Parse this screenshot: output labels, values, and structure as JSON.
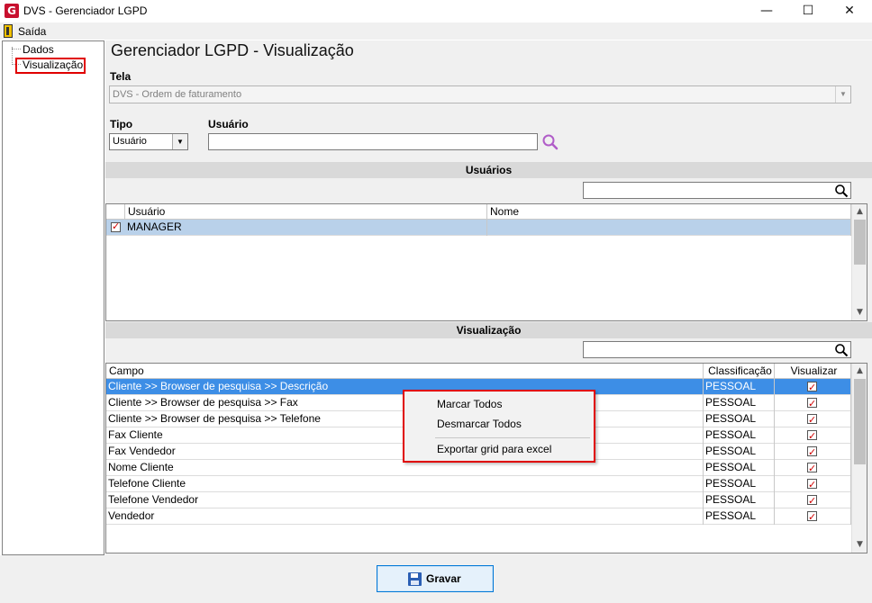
{
  "window": {
    "title": "DVS - Gerenciador LGPD",
    "logo_letter": "G",
    "minimize": "—",
    "maximize": "☐",
    "close": "✕"
  },
  "menu": {
    "exit_label": "Saída"
  },
  "tree": {
    "items": [
      {
        "label": "Dados"
      },
      {
        "label": "Visualização"
      }
    ]
  },
  "page": {
    "title": "Gerenciador LGPD - Visualização"
  },
  "form": {
    "tela_label": "Tela",
    "tela_value": "DVS - Ordem de faturamento",
    "tipo_label": "Tipo",
    "tipo_value": "Usuário",
    "usuario_label": "Usuário",
    "usuario_value": ""
  },
  "usuarios": {
    "heading": "Usuários",
    "filter_value": "",
    "columns": [
      "Usuário",
      "Nome"
    ],
    "rows": [
      {
        "checked": true,
        "usuario": "MANAGER",
        "nome": ""
      }
    ]
  },
  "visualizacao": {
    "heading": "Visualização",
    "filter_value": "",
    "columns": [
      "Campo",
      "Classificação",
      "Visualizar"
    ],
    "rows": [
      {
        "campo": "Cliente >> Browser de pesquisa >> Descrição",
        "classificacao": "PESSOAL",
        "visualizar": true
      },
      {
        "campo": "Cliente >> Browser de pesquisa >> Fax",
        "classificacao": "PESSOAL",
        "visualizar": true
      },
      {
        "campo": "Cliente >> Browser de pesquisa >> Telefone",
        "classificacao": "PESSOAL",
        "visualizar": true
      },
      {
        "campo": "Fax Cliente",
        "classificacao": "PESSOAL",
        "visualizar": true
      },
      {
        "campo": "Fax Vendedor",
        "classificacao": "PESSOAL",
        "visualizar": true
      },
      {
        "campo": "Nome Cliente",
        "classificacao": "PESSOAL",
        "visualizar": true
      },
      {
        "campo": "Telefone Cliente",
        "classificacao": "PESSOAL",
        "visualizar": true
      },
      {
        "campo": "Telefone Vendedor",
        "classificacao": "PESSOAL",
        "visualizar": true
      },
      {
        "campo": "Vendedor",
        "classificacao": "PESSOAL",
        "visualizar": true
      }
    ]
  },
  "context_menu": {
    "items": [
      "Marcar Todos",
      "Desmarcar Todos",
      "Exportar grid para excel"
    ]
  },
  "footer": {
    "save_label": "Gravar"
  },
  "colors": {
    "selection": "#3d8ee6",
    "highlight_border": "#e00000",
    "logo": "#c8102e",
    "search_icon": "#b05cc8"
  }
}
